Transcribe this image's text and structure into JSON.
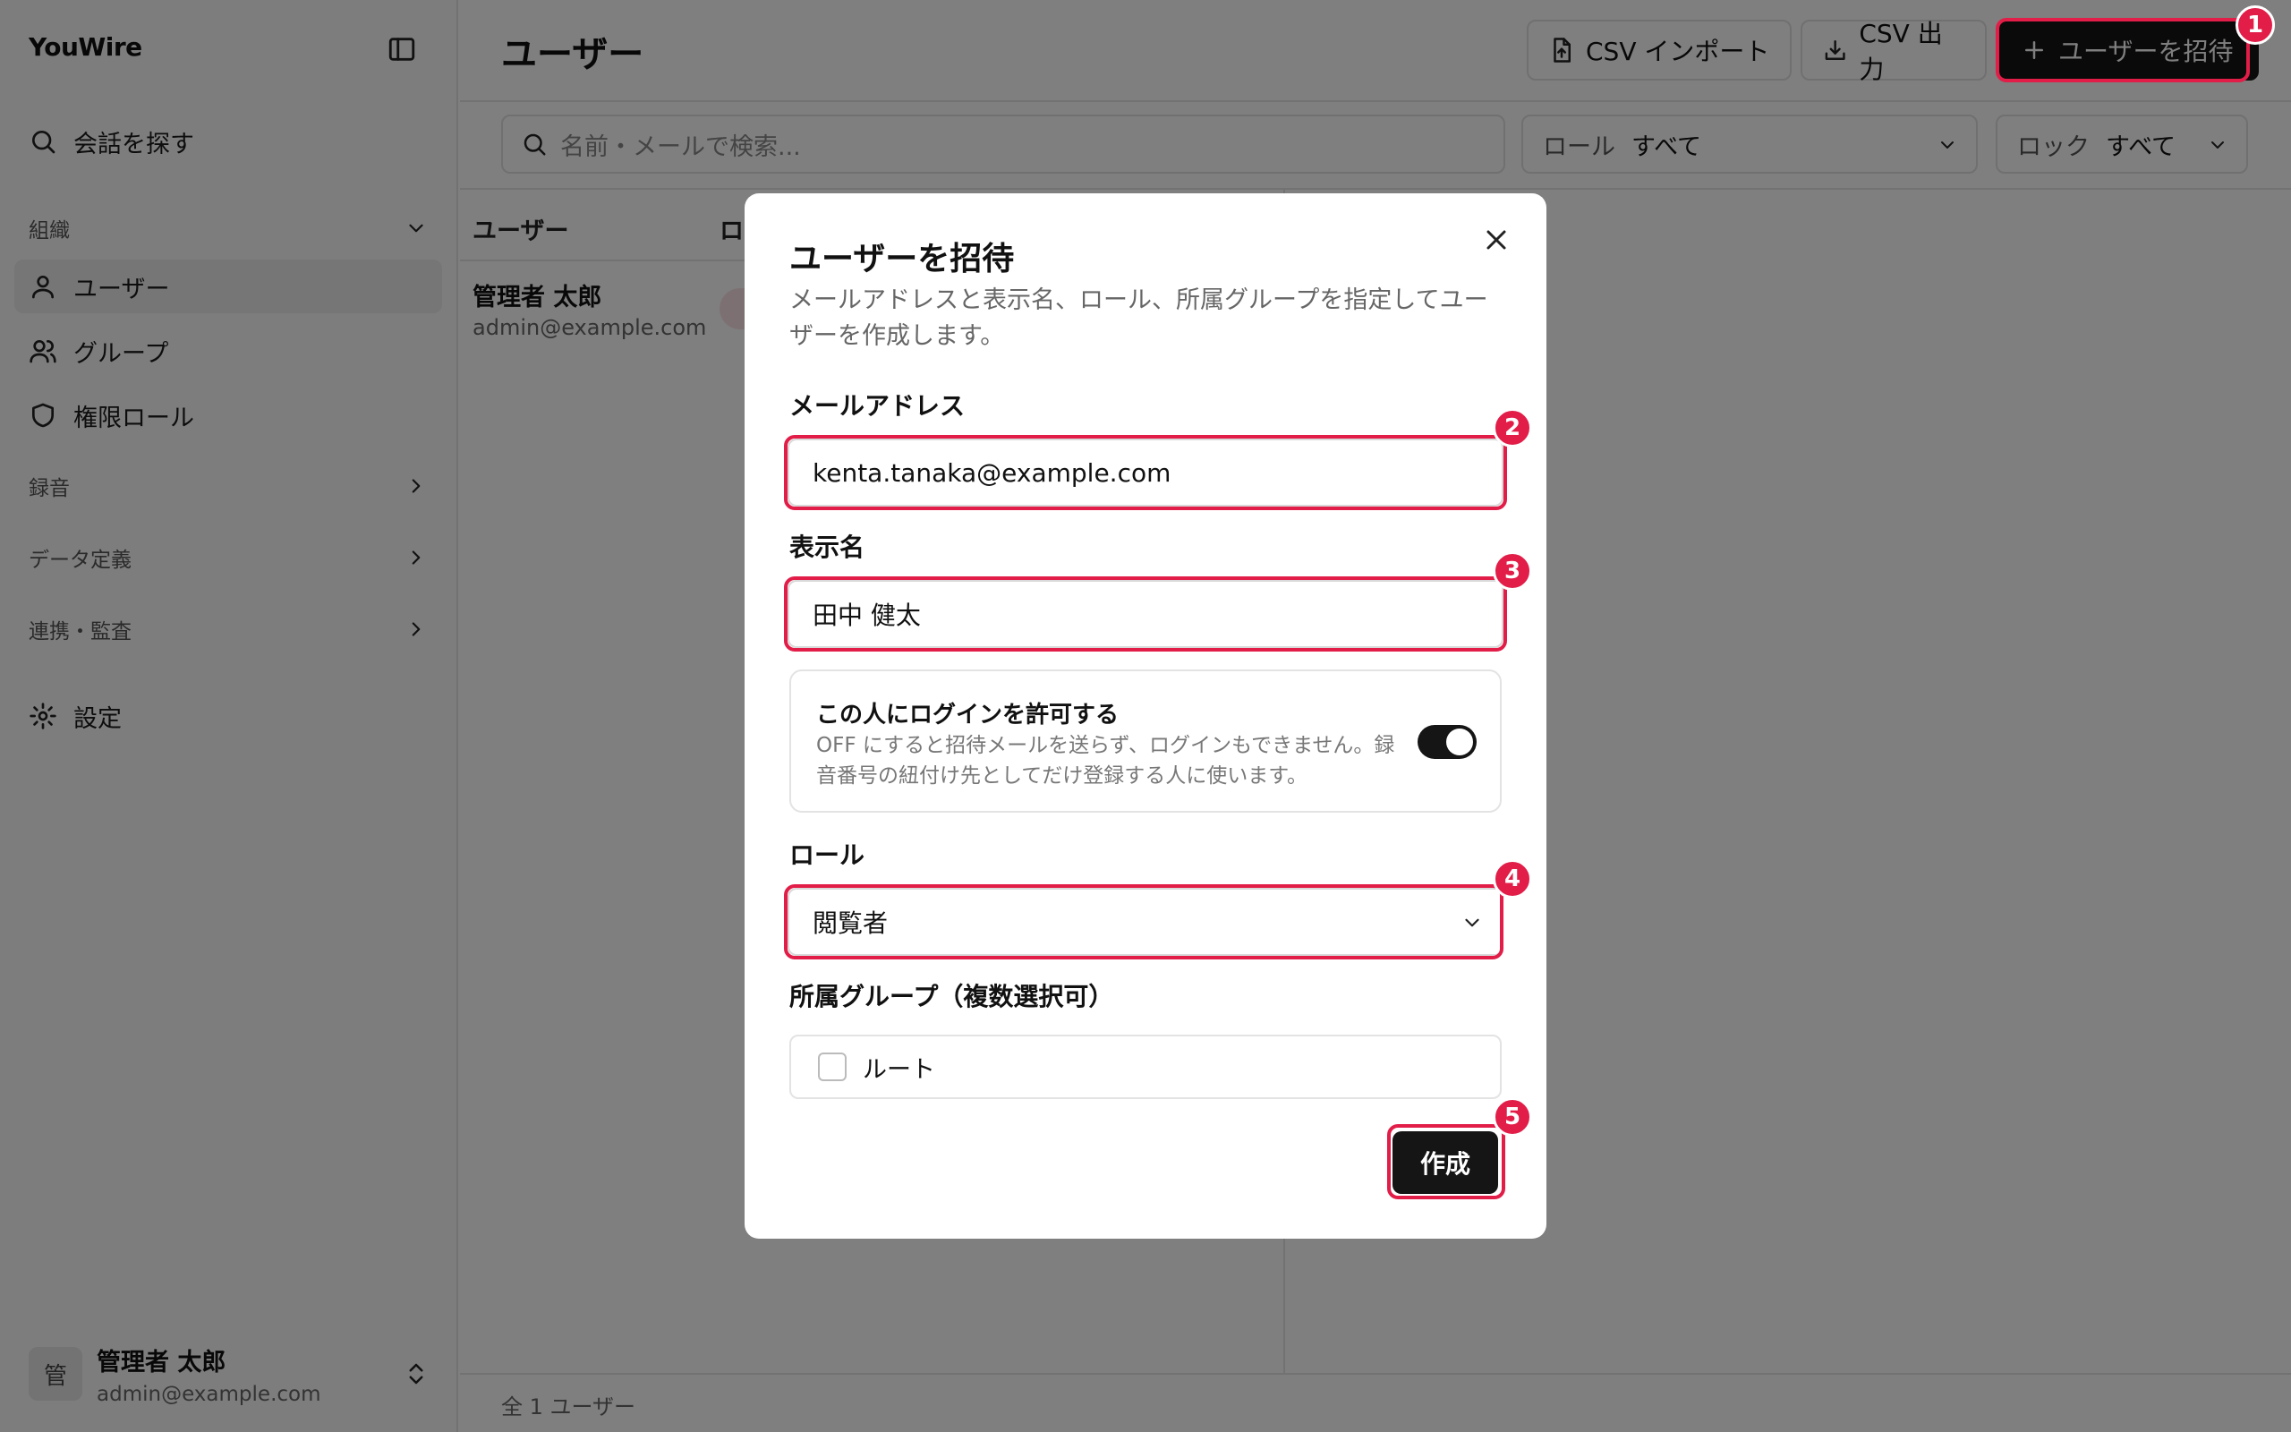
{
  "app": {
    "brand": "YouWire"
  },
  "sidebar": {
    "search_label": "会話を探す",
    "section_org": "組織",
    "items": [
      {
        "label": "ユーザー",
        "icon": "user-icon"
      },
      {
        "label": "グループ",
        "icon": "users-icon"
      },
      {
        "label": "権限ロール",
        "icon": "shield-icon"
      }
    ],
    "section_recording": "録音",
    "section_data": "データ定義",
    "section_integration": "連携・監査",
    "settings_label": "設定",
    "user": {
      "avatar": "管",
      "name": "管理者 太郎",
      "email": "admin@example.com"
    }
  },
  "header": {
    "title": "ユーザー",
    "import_label": "CSV インポート",
    "export_label": "CSV 出力",
    "invite_label": "ユーザーを招待"
  },
  "filters": {
    "search_placeholder": "名前・メールで検索...",
    "role_label": "ロール",
    "role_value": "すべて",
    "lock_label": "ロック",
    "lock_value": "すべて"
  },
  "table": {
    "columns": [
      "ユーザー",
      "ロ"
    ],
    "rows": [
      {
        "name": "管理者 太郎",
        "email": "admin@example.com",
        "role_chip": "管"
      }
    ]
  },
  "footer": {
    "count": "全 1 ユーザー"
  },
  "modal": {
    "title": "ユーザーを招待",
    "description": "メールアドレスと表示名、ロール、所属グループを指定してユーザーを作成します。",
    "email_label": "メールアドレス",
    "email_value": "kenta.tanaka@example.com",
    "name_label": "表示名",
    "name_value": "田中 健太",
    "login_title": "この人にログインを許可する",
    "login_desc": "OFF にすると招待メールを送らず、ログインもできません。録音番号の紐付け先としてだけ登録する人に使います。",
    "login_enabled": true,
    "role_label": "ロール",
    "role_value": "閲覧者",
    "groups_label": "所属グループ（複数選択可）",
    "group_option": "ルート",
    "create_label": "作成"
  },
  "annotations": [
    "1",
    "2",
    "3",
    "4",
    "5"
  ],
  "colors": {
    "accent": "#e11d48",
    "primary": "#151515"
  }
}
